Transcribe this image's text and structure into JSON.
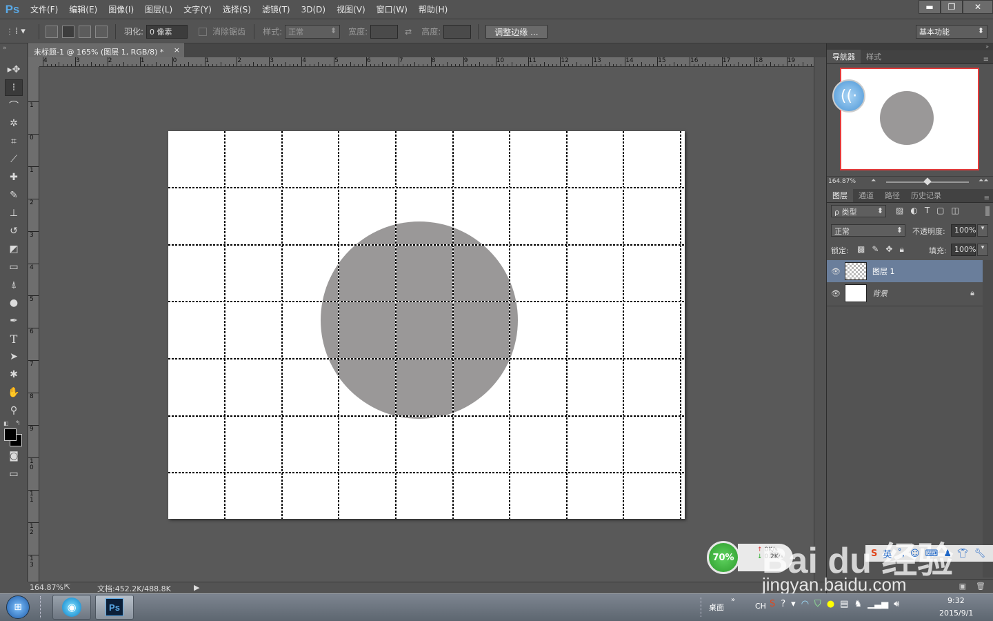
{
  "app": {
    "logo": "Ps"
  },
  "menu": [
    "文件(F)",
    "编辑(E)",
    "图像(I)",
    "图层(L)",
    "文字(Y)",
    "选择(S)",
    "滤镜(T)",
    "3D(D)",
    "视图(V)",
    "窗口(W)",
    "帮助(H)"
  ],
  "window_controls": {
    "minimize": "▬",
    "restore": "❐",
    "close": "✕"
  },
  "options": {
    "feather_label": "羽化:",
    "feather_value": "0 像素",
    "antialias_label": "消除锯齿",
    "style_label": "样式:",
    "style_value": "正常",
    "width_label": "宽度:",
    "height_label": "高度:",
    "refine_edge": "调整边缘 ...",
    "workspace": "基本功能"
  },
  "document": {
    "tab_title": "未标题-1 @ 165% (图层 1, RGB/8) *",
    "tab_close": "×",
    "zoom": "164.87%",
    "doc_size": "文档:452.2K/488.8K"
  },
  "ruler": {
    "h_labels": [
      "4",
      "3",
      "2",
      "1",
      "0",
      "1",
      "2",
      "3",
      "4",
      "5",
      "6",
      "7",
      "8",
      "9",
      "10",
      "11",
      "12",
      "13",
      "14",
      "15",
      "16",
      "17",
      "18",
      "19"
    ],
    "v_labels": [
      "1",
      "0",
      "1",
      "2",
      "3",
      "4",
      "5",
      "6",
      "7",
      "8",
      "9",
      "10",
      "11",
      "12",
      "13"
    ]
  },
  "navigator": {
    "tabs": [
      "导航器",
      "样式"
    ],
    "zoom": "164.87%"
  },
  "layers_panel": {
    "tabs": [
      "图层",
      "通道",
      "路径",
      "历史记录"
    ],
    "filter_value": "ρ 类型",
    "blend_mode": "正常",
    "opacity_label": "不透明度:",
    "opacity_value": "100%",
    "lock_label": "锁定:",
    "fill_label": "填充:",
    "fill_value": "100%",
    "layers": [
      {
        "name": "图层 1",
        "selected": true
      },
      {
        "name": "背景",
        "locked": true
      }
    ]
  },
  "watermark": {
    "gauge": "70%",
    "up_speed": "0K/s",
    "down_speed": "0.2K/s",
    "brand": "Bai du 经验",
    "url": "jingyan.baidu.com"
  },
  "taskbar": {
    "desktop_label": "桌面",
    "lang": "CH",
    "time": "9:32",
    "date": "2015/9/1"
  },
  "colors": {
    "accent": "#5aa9e6",
    "circle": "#9a9898",
    "nav_border": "#e23a3a",
    "selected_layer": "#6a7e9b"
  }
}
